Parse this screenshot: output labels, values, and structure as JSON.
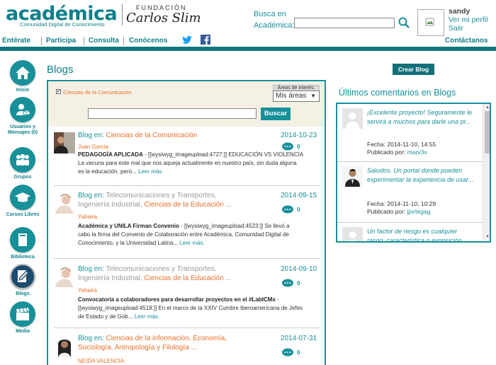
{
  "header": {
    "logo": "académica",
    "logo_sub": "Comunidad Digital de Conocimiento",
    "fundacion_top": "FUNDACIÓN",
    "fundacion_name": "Carlos Slim",
    "search_label_1": "Busca en",
    "search_label_2": "Académica:",
    "search_placeholder": "",
    "user_name": "sandy",
    "ver_perfil": "Ver mi perfil",
    "salir": "Salir"
  },
  "nav": {
    "items": [
      "Entérate",
      "Participa",
      "Consulta",
      "Conócenos"
    ],
    "contact": "Contáctanos"
  },
  "left_menu": [
    {
      "label": "Inicio",
      "icon": "home-icon"
    },
    {
      "label": "Usuarios y Mensajes (0)",
      "icon": "users-messages-icon"
    },
    {
      "label": "Grupos",
      "icon": "groups-icon"
    },
    {
      "label": "Cursos Libres",
      "icon": "graduation-cap-icon"
    },
    {
      "label": "Biblioteca",
      "icon": "library-icon"
    },
    {
      "label": "Blogs",
      "icon": "blog-pen-icon"
    },
    {
      "label": "Media",
      "icon": "media-clapper-icon"
    }
  ],
  "main": {
    "title": "Blogs",
    "filter_checkbox": "Ciencias de la Comunicación",
    "areas_label": "Áreas de interés:",
    "areas_selected": "Mis áreas",
    "search_button": "Buscar",
    "posts": [
      {
        "blog_prefix": "Blog en:",
        "category": "Ciencias de la Comunicación",
        "category_rest": "",
        "date": "2014-10-23",
        "comments": "0",
        "author": "Juan Garcia",
        "title": "PEDAGOGÍA APLICADA",
        "body": " - [[wysiwyg_imageupload:4727:]] EDUCACIÓN VS VIOLENCIA La vacuna para este mal que nos aqueja actualmente en nuestro país, sin duda alguna es la educación, pero...",
        "more": "Leer más."
      },
      {
        "blog_prefix": "Blog en:",
        "category_pre": "Telecomunicaciones y Transportes, Ingeniería Industrial,",
        "category": "Ciencias de la Educación",
        "category_rest": "...",
        "date": "2014-09-15",
        "comments": "0",
        "author": "Yahaira",
        "title": "Académica y UNILA Firman Convenio",
        "body": " - [[wysiwyg_imageupload:4523:]] Se llevó a cabo la firma del Convenio de Colaboración entre Académica, Comunidad Digital de Conocimiento, y la Universidad Latina...",
        "more": "Leer más."
      },
      {
        "blog_prefix": "Blog en:",
        "category_pre": "Telecomunicaciones y Transportes, Ingeniería Industrial,",
        "category": "Ciencias de la Educación",
        "category_rest": "...",
        "date": "2014-09-10",
        "comments": "0",
        "author": "Yahaira",
        "title": "Convocatoria a colaboradores para desarrollar proyectos en el #LabICMx",
        "body": " - [[wysiwyg_imageupload:4519:]]          En el marco de la XXIV Cumbre Iberoamericana de Jefes de Estado y de Gob...",
        "more": "Leer más."
      },
      {
        "blog_prefix": "Blog en:",
        "category": "Ciencias de la información, Economía, Sociología, Antropología y Filología",
        "category_rest": "...",
        "date": "2014-07-31",
        "comments": "0",
        "author": "NEIDA VALENCIA",
        "title": "",
        "body": "",
        "more": ""
      }
    ]
  },
  "right": {
    "crear_blog": "Crear Blog",
    "title": "Últimos comentarios en Blogs",
    "comments": [
      {
        "text": "¡Excelente proyecto! Seguramente le servirá a muchos para darle una pr...",
        "fecha_label": "Fecha:",
        "fecha": "2014-11-10, 14:55",
        "pub_label": "Publicado por:",
        "author": "marv3x"
      },
      {
        "text": "Saludos. Un portal donde pueden experimentar la experiencia de usar...",
        "fecha_label": "Fecha:",
        "fecha": "2014-11-10, 10:29",
        "pub_label": "Publicado por:",
        "author": "jjortegag"
      },
      {
        "text": "Un factor de riesgo es cualquier rasgo, característica o exposición...",
        "fecha_label": "",
        "fecha": "",
        "pub_label": "",
        "author": ""
      }
    ]
  },
  "colors": {
    "accent": "#17909a",
    "orange": "#e8702a",
    "dark_bar": "#12777f"
  }
}
